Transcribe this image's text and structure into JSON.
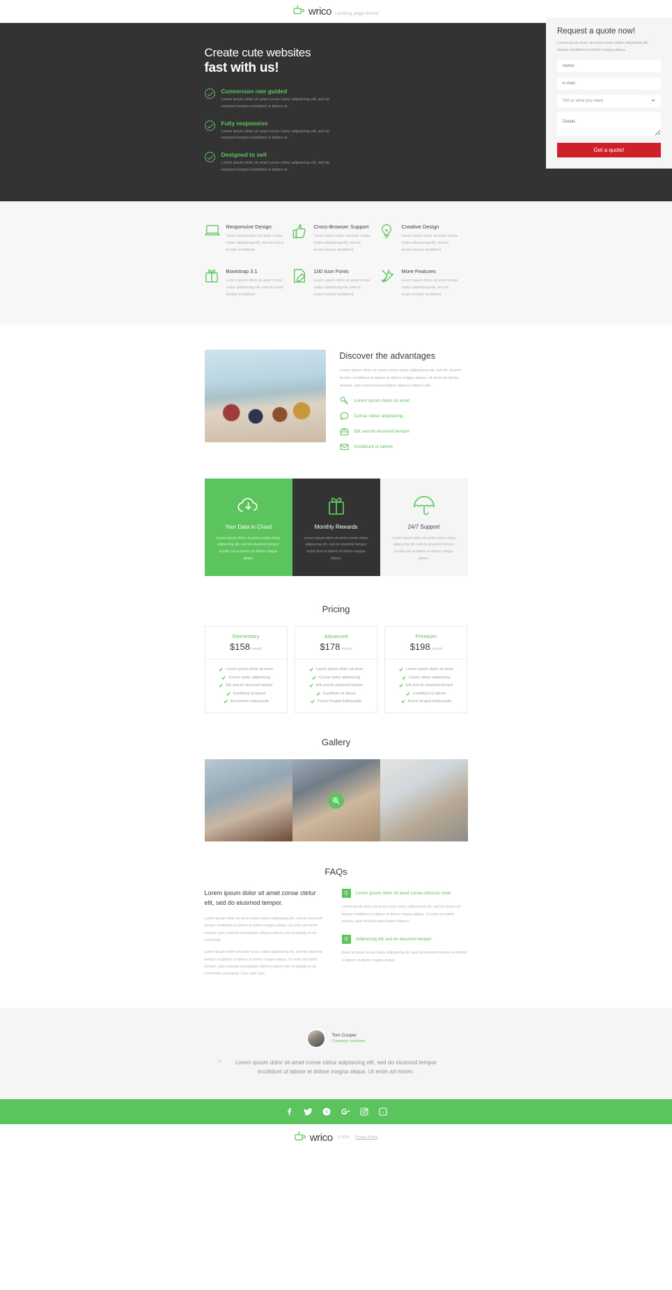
{
  "brand": {
    "name": "wrico",
    "tagline": "Landing page theme",
    "accent": "#5cc45c",
    "dark": "#333333",
    "cta": "#cf2029"
  },
  "hero": {
    "title_line1": "Create cute websites",
    "title_line2": "fast with us!",
    "benefits": [
      {
        "title": "Conversion rate guided",
        "text": "Lorem ipsum dolor sit amet conse ctetur adipisicing elit, sed do eiusmod tempor incididunt ut labore et."
      },
      {
        "title": "Fully responsive",
        "text": "Lorem ipsum dolor sit amet conse ctetur adipisicing elit, sed do eiusmod tempor incididunt ut labore et."
      },
      {
        "title": "Designed to sell",
        "text": "Lorem ipsum dolor sit amet conse ctetur adipisicing elit, sed do eiusmod tempor incididunt ut labore et."
      }
    ]
  },
  "quote_form": {
    "title": "Request a quote now!",
    "subtitle": "Lorem ipsum dolor sit amet conse ctetur adipiscing elit, tempor incididunt et dolore magna aliqua.",
    "name_placeholder": "Name:",
    "email_placeholder": "E-mail:",
    "select_value": "Tell us what you need",
    "details_placeholder": "Details",
    "submit_label": "Get a quote!"
  },
  "features": [
    {
      "icon": "laptop-icon",
      "title": "Responsive Design",
      "text": "Lorem ipsum dolor sit amet conse ctetur adipisicing elit, sed do eiusd tempor incididunt."
    },
    {
      "icon": "thumbs-up-icon",
      "title": "Cross-Browser Support",
      "text": "Lorem ipsum dolor sit amet conse ctetur adipisicing elit, sed do eiusm tempor incididunt."
    },
    {
      "icon": "lightbulb-icon",
      "title": "Creative Design",
      "text": "Lorem ipsum dolor sit amet conse ctetur adipisicing elit, sed do eiusm tempor incididunt."
    },
    {
      "icon": "gift-icon",
      "title": "Bootstrap 3.1",
      "text": "Lorem ipsum dolor sit amet conse ctetur adipisicing elit, sed do eiusd tempor incididunt."
    },
    {
      "icon": "pencil-note-icon",
      "title": "100 Icon Fonts",
      "text": "Lorem ipsum dolor sit amet conse ctetur adipisicing elit, sed do eiusm tempor incididunt."
    },
    {
      "icon": "tools-icon",
      "title": "More Features",
      "text": "Lorem ipsum dolor sit amet conse ctetur adipisicing elit, sed do eiusm tempor incididunt."
    }
  ],
  "advantages": {
    "title": "Discover the advantages",
    "text": "Lorem ipsum dolor sit amet conse ctetur adipisicing elit, sed do eiusmo tempor incididunt ut labore et dolore magna aliqua. Ut enim ad minim veniam, quis nostrud exercitation ullamco laboris nisi.",
    "items": [
      {
        "icon": "key-icon",
        "label": "Lorem ipsum dolor sit amet"
      },
      {
        "icon": "chat-icon",
        "label": "Conse ctetur adipisicing"
      },
      {
        "icon": "briefcase-icon",
        "label": "Elit sed do eiusmod tempor"
      },
      {
        "icon": "mail-icon",
        "label": "Incididunt ut labore"
      }
    ]
  },
  "promos": [
    {
      "icon": "cloud-download-icon",
      "title": "Your Data in Cloud",
      "text": "Lorem ipsum dolor sit amet conse ctetur adipiscing elit, sed do eiusmod tempor incidid unt ut labore et dolore magna aliqua.",
      "style": "green"
    },
    {
      "icon": "gift-icon",
      "title": "Monthly Rewards",
      "text": "Lorem ipsum dolor sit amet conse ctetur adipiscing elit, sed do eiusmod tempor incidi dunt ut labore et dolore magna aliqua.",
      "style": "dark"
    },
    {
      "icon": "umbrella-icon",
      "title": "24/7 Support",
      "text": "Lorem ipsum dolor sit amet conse ctetur adipiscing elit, sed do eiusmod tempor incidict unt ut labore et dolore magna aliqua.",
      "style": "light"
    }
  ],
  "pricing": {
    "title": "Pricing",
    "plans": [
      {
        "name": "Elementary",
        "price": "$158",
        "per": "/ month",
        "features": [
          "Lorem ipsum dolor sit amet",
          "Conse ctetur adipisicing",
          "Elit sed do eiusmod tempor",
          "Incididunt ut labore",
          "Accumsan malesuada"
        ]
      },
      {
        "name": "Advanced",
        "price": "$178",
        "per": "/ month",
        "features": [
          "Lorem ipsum dolor sit amet",
          "Conse ctetur adipisicing",
          "Elit sed do eiusmod tempor",
          "Incididunt ut labore",
          "Fusce feugiat malesuada"
        ]
      },
      {
        "name": "Premium",
        "price": "$198",
        "per": "/ month",
        "features": [
          "Lorem ipsum dolor sit amet",
          "Conse ctetur adipisicing",
          "Elit sed do eiusmod tempor",
          "Incididunt ut labore",
          "Fusce feugiat malesuada"
        ]
      }
    ]
  },
  "gallery": {
    "title": "Gallery",
    "zoom_icon": "magnifier-plus-icon",
    "items": [
      "gallery-image-1",
      "gallery-image-2",
      "gallery-image-3"
    ]
  },
  "faqs": {
    "title": "FAQs",
    "lead": "Lorem ipsum dolor sit amet conse ctetur elit, sed do eiusmod tempor.",
    "left_paragraphs": [
      "Lorem ipsum dolor sit amet conse ctetur adipisicing elit, sed do eiusmod tempor incididunt ut labore et dolore magna aliqua. Ut enim ad minim veniam, quis nostrud exercitation ullamco laboris nisi ut aliquip ex ea commodo.",
      "Lorem ipsum dolor sit amet conse ctetur adipisicing elit, sed do eiusmod tempor incididunt ut labore et dolore magna aliqua. Ut enim ad minim veniam, quis nostrud exercitation ullamco laboris nisi ut aliquip ex ea commodo consequat. Duis aute irure."
    ],
    "items": [
      {
        "badge": "Q",
        "question": "Lorem ipsum dolor sit amet conse ctetursis nostr",
        "answer": "Lorem ipsum dolor sit amet conse ctetur adipisicing elit, sed do eiusm od tempor incididunt ut labore et dolore magna aliqua. Ut enim ad minim veniam, quis nostrud exercitation ullamco."
      },
      {
        "badge": "Q",
        "question": "Adipisicing elit sed do eiusmod tempor",
        "answer": "Dolor sit amet conse ctetur adipisicing elit, sed do eiusmod tempor incididunt ut labore et dolore magna aliqua."
      }
    ]
  },
  "testimonial": {
    "name": "Tom Cooper",
    "role": "Company customer",
    "quote": "Lorem ipsum dolor sit amet conse ctetur adipisicing elit, sed do eiusmod tempor incididunt ut labore et dolore magna aliqua. Ut enim ad minim."
  },
  "footer": {
    "social": [
      {
        "icon": "facebook-icon",
        "glyph": "f"
      },
      {
        "icon": "twitter-icon",
        "glyph": "t"
      },
      {
        "icon": "skype-icon",
        "glyph": "s"
      },
      {
        "icon": "google-plus-icon",
        "glyph": "g+"
      },
      {
        "icon": "instagram-icon",
        "glyph": "i"
      },
      {
        "icon": "vimeo-icon",
        "glyph": "v"
      }
    ],
    "copyright": "© 2015.",
    "privacy": "Privacy Policy"
  }
}
